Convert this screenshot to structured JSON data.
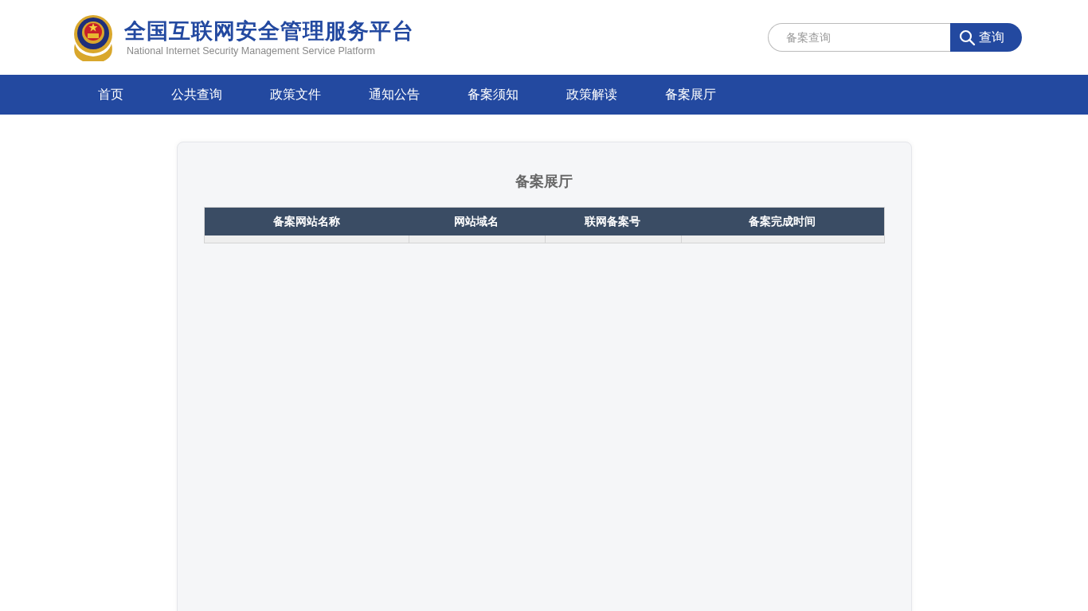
{
  "header": {
    "title": "全国互联网安全管理服务平台",
    "subtitle": "National Internet Security Management Service Platform",
    "search": {
      "placeholder": "备案查询",
      "button": "查询"
    }
  },
  "nav": [
    "首页",
    "公共查询",
    "政策文件",
    "通知公告",
    "备案须知",
    "政策解读",
    "备案展厅"
  ],
  "panel": {
    "title": "备案展厅",
    "table": {
      "columns": [
        "备案网站名称",
        "网站域名",
        "联网备案号",
        "备案完成时间"
      ]
    }
  }
}
